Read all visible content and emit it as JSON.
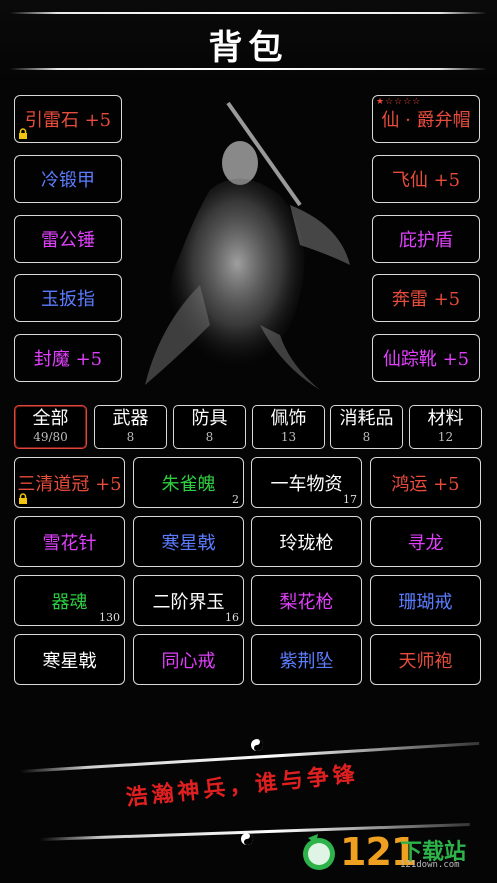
{
  "header": {
    "title": "背包"
  },
  "equipment_left": [
    {
      "label": "引雷石 +5",
      "color": "#e74c3c",
      "locked": true
    },
    {
      "label": "冷锻甲",
      "color": "#5b7cff"
    },
    {
      "label": "雷公锤",
      "color": "#e040fb"
    },
    {
      "label": "玉扳指",
      "color": "#5b7cff"
    },
    {
      "label": "封魔 +5",
      "color": "#e040fb"
    }
  ],
  "equipment_right": [
    {
      "label": "仙 · 爵弁帽",
      "color": "#e74c3c",
      "stars": "★☆☆☆☆"
    },
    {
      "label": "飞仙 +5",
      "color": "#e74c3c"
    },
    {
      "label": "庇护盾",
      "color": "#e040fb"
    },
    {
      "label": "奔雷 +5",
      "color": "#e74c3c"
    },
    {
      "label": "仙踪靴 +5",
      "color": "#e040fb"
    }
  ],
  "tabs": [
    {
      "name": "全部",
      "count": "49/80",
      "active": true
    },
    {
      "name": "武器",
      "count": "8"
    },
    {
      "name": "防具",
      "count": "8"
    },
    {
      "name": "佩饰",
      "count": "13"
    },
    {
      "name": "消耗品",
      "count": "8"
    },
    {
      "name": "材料",
      "count": "12"
    }
  ],
  "items": [
    {
      "label": "三清道冠 +5",
      "color": "#e74c3c",
      "locked": true
    },
    {
      "label": "朱雀魄",
      "color": "#2ecc40",
      "qty": "2"
    },
    {
      "label": "一车物资",
      "color": "#ffffff",
      "qty": "17"
    },
    {
      "label": "鸿运 +5",
      "color": "#e74c3c"
    },
    {
      "label": "雪花针",
      "color": "#e040fb"
    },
    {
      "label": "寒星戟",
      "color": "#5b7cff"
    },
    {
      "label": "玲珑枪",
      "color": "#ffffff"
    },
    {
      "label": "寻龙",
      "color": "#e040fb"
    },
    {
      "label": "器魂",
      "color": "#2ecc40",
      "qty": "130"
    },
    {
      "label": "二阶界玉",
      "color": "#ffffff",
      "qty": "16"
    },
    {
      "label": "梨花枪",
      "color": "#e040fb"
    },
    {
      "label": "珊瑚戒",
      "color": "#5b7cff"
    },
    {
      "label": "寒星戟",
      "color": "#ffffff"
    },
    {
      "label": "同心戒",
      "color": "#e040fb"
    },
    {
      "label": "紫荆坠",
      "color": "#5b7cff"
    },
    {
      "label": "天师袍",
      "color": "#e74c3c"
    }
  ],
  "slogan": "浩瀚神兵，谁与争锋",
  "watermark": {
    "number": "121",
    "text": "下载站",
    "url": "121down.com"
  }
}
